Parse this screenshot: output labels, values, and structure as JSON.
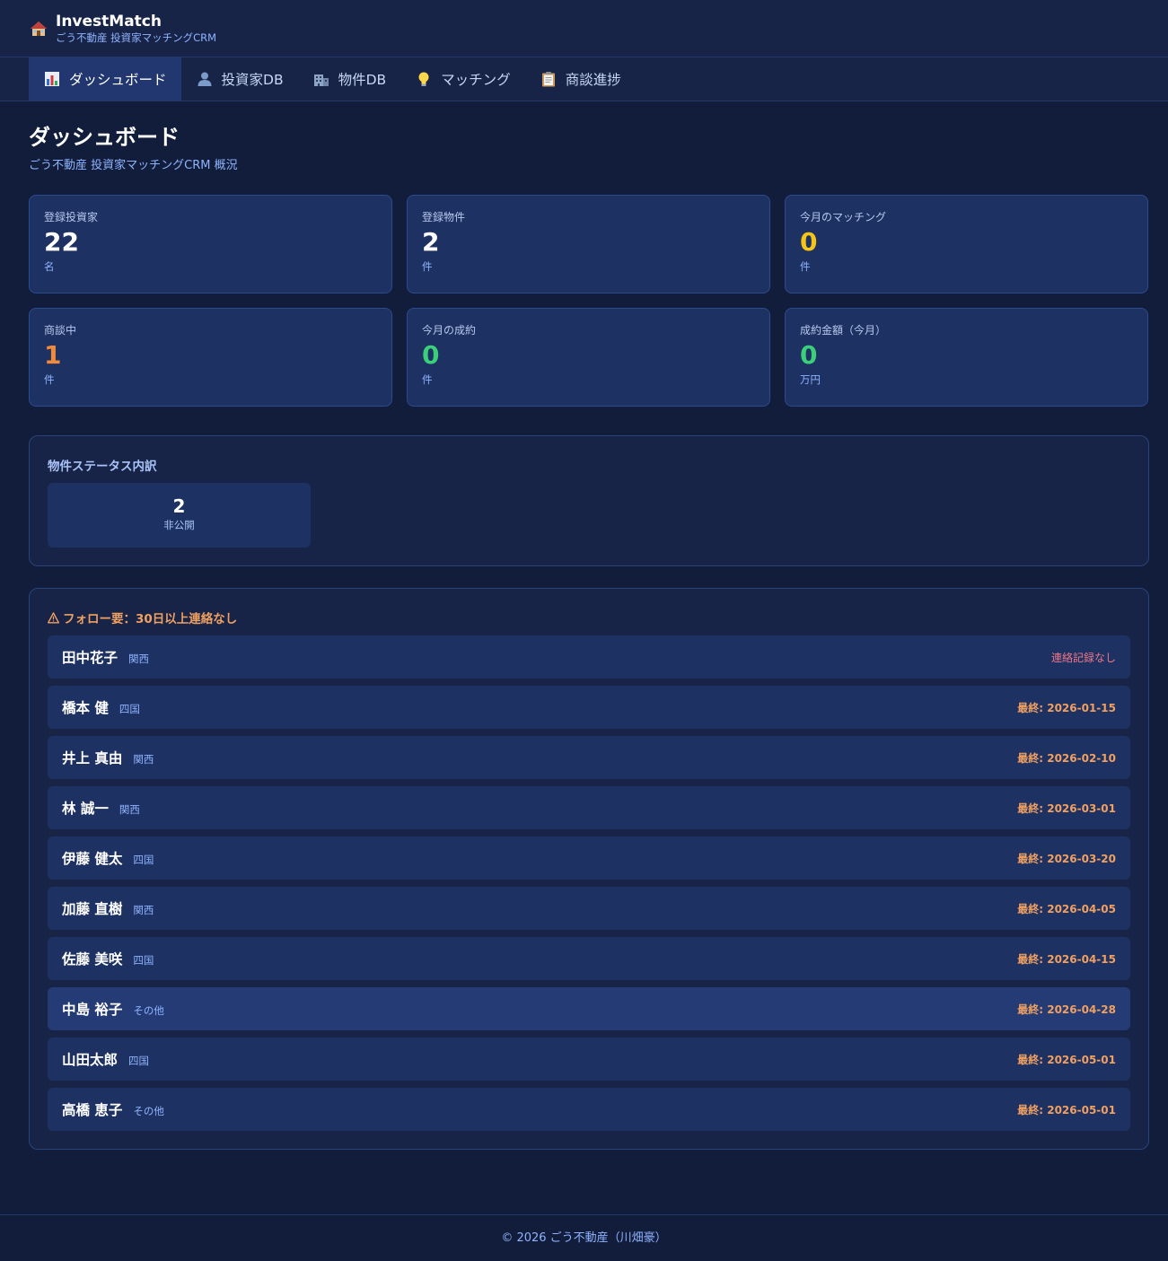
{
  "app": {
    "name": "InvestMatch",
    "subtitle": "ごう不動産 投資家マッチングCRM",
    "logo_icon": "house-icon"
  },
  "nav": [
    {
      "label": "ダッシュボード",
      "icon": "bar-chart-icon",
      "active": true
    },
    {
      "label": "投資家DB",
      "icon": "person-icon",
      "active": false
    },
    {
      "label": "物件DB",
      "icon": "building-icon",
      "active": false
    },
    {
      "label": "マッチング",
      "icon": "lightbulb-icon",
      "active": false
    },
    {
      "label": "商談進捗",
      "icon": "clipboard-icon",
      "active": false
    }
  ],
  "page": {
    "title": "ダッシュボード",
    "subtitle": "ごう不動産 投資家マッチングCRM 概況"
  },
  "stats": [
    {
      "label": "登録投資家",
      "value": "22",
      "unit": "名",
      "color": "#ffffff"
    },
    {
      "label": "登録物件",
      "value": "2",
      "unit": "件",
      "color": "#ffffff"
    },
    {
      "label": "今月のマッチング",
      "value": "0",
      "unit": "件",
      "color": "#f5c518"
    },
    {
      "label": "商談中",
      "value": "1",
      "unit": "件",
      "color": "#f08a3c"
    },
    {
      "label": "今月の成約",
      "value": "0",
      "unit": "件",
      "color": "#3ccf7a"
    },
    {
      "label": "成約金額（今月）",
      "value": "0",
      "unit": "万円",
      "color": "#3ccf7a"
    }
  ],
  "property_status": {
    "title": "物件ステータス内訳",
    "items": [
      {
        "count": "2",
        "label": "非公開"
      }
    ]
  },
  "follow_up": {
    "title": "フォロー要：30日以上連絡なし",
    "icon": "warning-icon",
    "rows": [
      {
        "name": "田中花子",
        "region": "関西",
        "last": "連絡記録なし",
        "no_record": true
      },
      {
        "name": "橋本 健",
        "region": "四国",
        "last": "最終: 2026-01-15"
      },
      {
        "name": "井上 真由",
        "region": "関西",
        "last": "最終: 2026-02-10"
      },
      {
        "name": "林 誠一",
        "region": "関西",
        "last": "最終: 2026-03-01"
      },
      {
        "name": "伊藤 健太",
        "region": "四国",
        "last": "最終: 2026-03-20"
      },
      {
        "name": "加藤 直樹",
        "region": "関西",
        "last": "最終: 2026-04-05"
      },
      {
        "name": "佐藤 美咲",
        "region": "四国",
        "last": "最終: 2026-04-15"
      },
      {
        "name": "中島 裕子",
        "region": "その他",
        "last": "最終: 2026-04-28",
        "highlight": true
      },
      {
        "name": "山田太郎",
        "region": "四国",
        "last": "最終: 2026-05-01"
      },
      {
        "name": "高橋 恵子",
        "region": "その他",
        "last": "最終: 2026-05-01"
      }
    ]
  },
  "footer": {
    "text": "© 2026 ごう不動産（川畑豪）"
  }
}
